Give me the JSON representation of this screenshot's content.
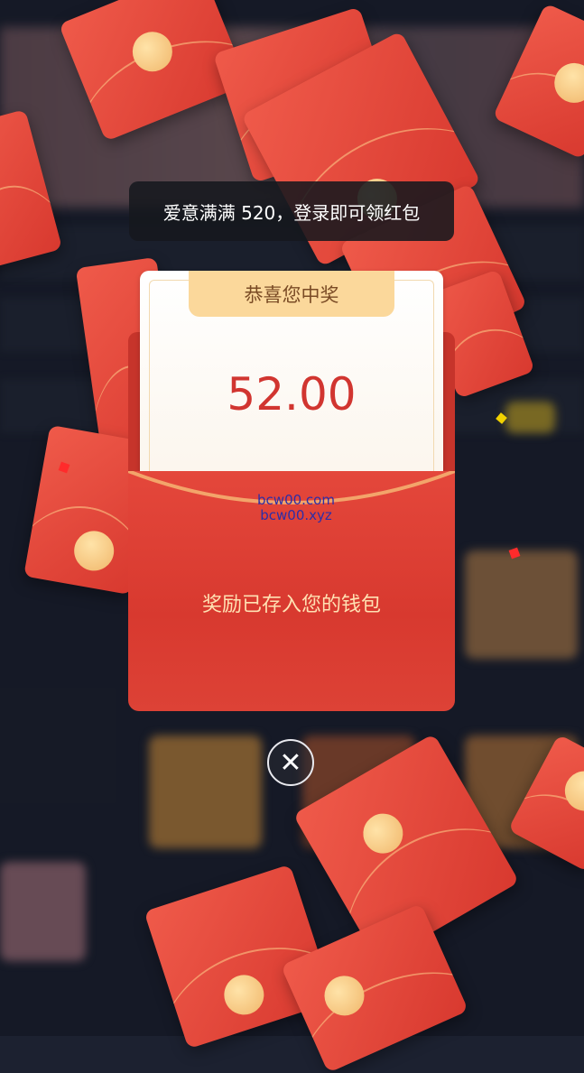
{
  "toast": {
    "text": "爱意满满 520，登录即可领红包"
  },
  "prize_card": {
    "header": "恭喜您中奖",
    "amount": "52.00",
    "message": "奖励已存入您的钱包"
  },
  "watermark": {
    "line1": "bcw00.com",
    "line2": "bcw00.xyz"
  },
  "close_button": {
    "icon": "close-icon",
    "label": "✕"
  },
  "colors": {
    "envelope_red": "#e0463a",
    "seal_gold": "#f4c27a",
    "amount_red": "#d13530",
    "ribbon_gold": "#fbd89b",
    "toast_bg": "#16181e"
  }
}
